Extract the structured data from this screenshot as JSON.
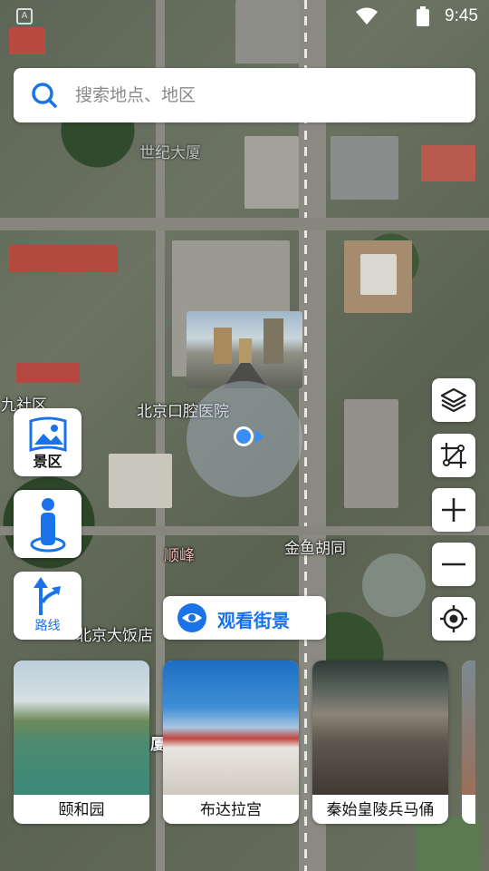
{
  "status_bar": {
    "time": "9:45"
  },
  "search": {
    "placeholder": "搜索地点、地区"
  },
  "map_labels": {
    "building_1": "世纪大厦",
    "hospital": "北京口腔医院",
    "community": "九社区",
    "street": "金鱼胡同",
    "shunfeng": "顺峰",
    "hotel": "北京大饭店",
    "xia": "厦"
  },
  "left_buttons": {
    "scenic": "景区",
    "route": "路线"
  },
  "street_view_button": {
    "label": "观看街景"
  },
  "cards": [
    {
      "name": "颐和园"
    },
    {
      "name": "布达拉宫"
    },
    {
      "name": "秦始皇陵兵马俑"
    }
  ],
  "colors": {
    "accent": "#1a73e8"
  }
}
